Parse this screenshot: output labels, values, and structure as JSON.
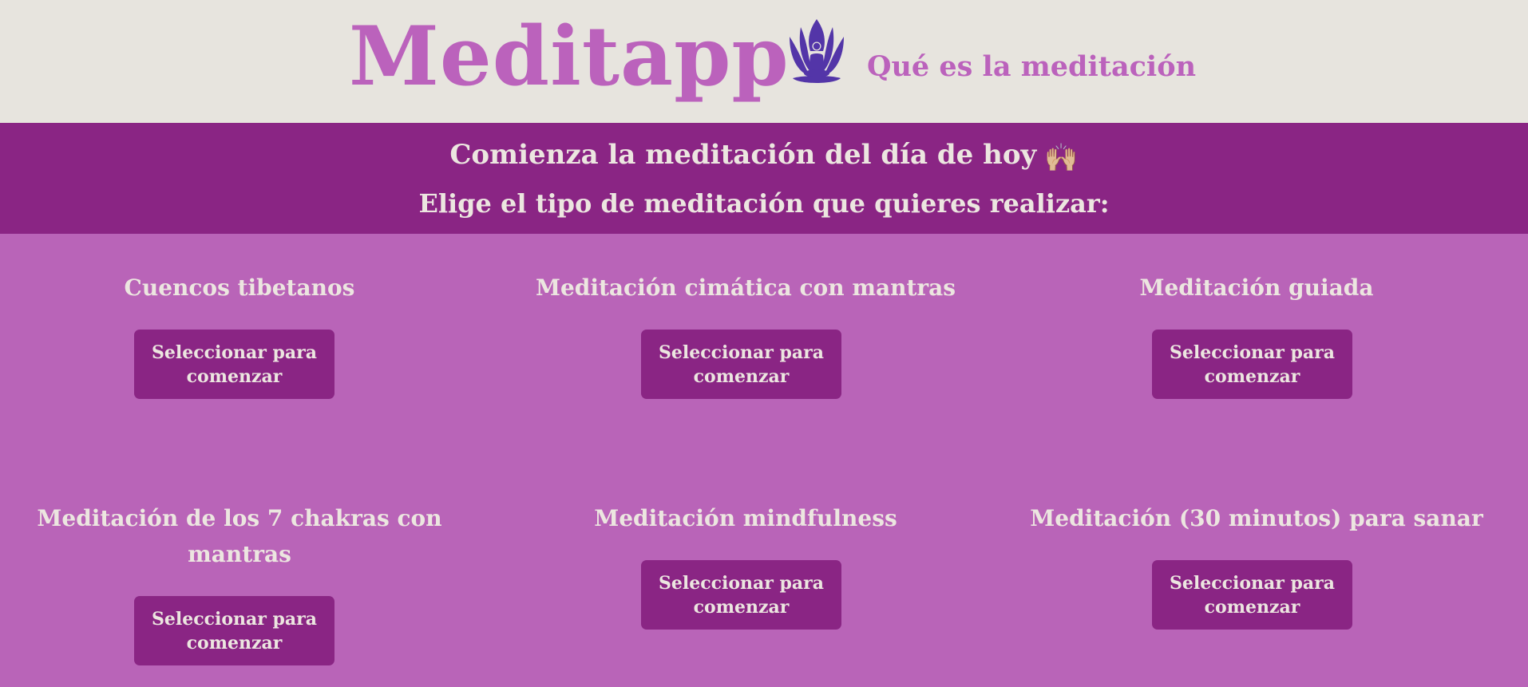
{
  "header": {
    "logo_text": "Meditapp",
    "nav_link": "Qué es la meditación",
    "logo_icon": "lotus-meditation-icon",
    "logo_icon_color": "#5335a8"
  },
  "banner": {
    "line1": "Comienza la meditación del día de hoy",
    "line1_emoji": "🙌🏼",
    "line2": "Elige el tipo de meditación que quieres realizar:"
  },
  "meditations": [
    {
      "title": "Cuencos tibetanos",
      "button": "Seleccionar para comenzar"
    },
    {
      "title": "Meditación cimática con mantras",
      "button": "Seleccionar para comenzar"
    },
    {
      "title": "Meditación guiada",
      "button": "Seleccionar para comenzar"
    },
    {
      "title": "Meditación de los 7 chakras con mantras",
      "button": "Seleccionar para comenzar"
    },
    {
      "title": "Meditación mindfulness",
      "button": "Seleccionar para comenzar"
    },
    {
      "title": "Meditación (30 minutos) para sanar",
      "button": "Seleccionar para comenzar"
    }
  ],
  "colors": {
    "header_bg": "#e7e4de",
    "brand_pink": "#bb62bc",
    "banner_bg": "#8a2584",
    "page_bg": "#b964b8",
    "light_text": "#ece6e0"
  }
}
